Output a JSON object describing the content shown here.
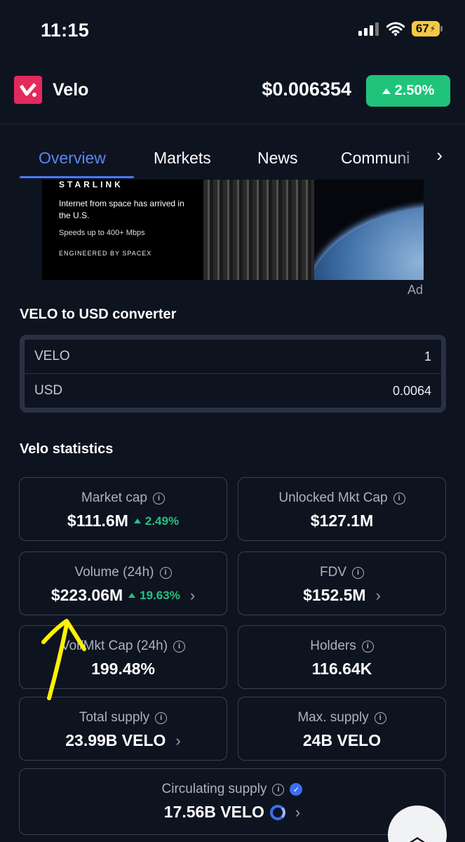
{
  "status_bar": {
    "time": "11:15",
    "battery": "67"
  },
  "header": {
    "coin_name": "Velo",
    "price": "$0.006354",
    "change": "2.50%",
    "logo_color": "#e4295c",
    "change_color": "#1fc47a"
  },
  "tabs": [
    {
      "label": "Overview",
      "active": true
    },
    {
      "label": "Markets"
    },
    {
      "label": "News"
    },
    {
      "label": "Communi"
    }
  ],
  "ad": {
    "brand": "STARLINK",
    "headline": "Internet from space has arrived in the U.S.",
    "speed": "Speeds up to 400+ Mbps",
    "engineered": "ENGINEERED BY SPACEX",
    "label": "Ad"
  },
  "converter": {
    "title": "VELO to USD converter",
    "rows": [
      {
        "label": "VELO",
        "value": "1"
      },
      {
        "label": "USD",
        "value": "0.0064"
      }
    ]
  },
  "stats": {
    "title": "Velo statistics",
    "market_cap": {
      "label": "Market cap",
      "value": "$111.6M",
      "change": "2.49%"
    },
    "unlocked_mkt_cap": {
      "label": "Unlocked Mkt Cap",
      "value": "$127.1M"
    },
    "volume": {
      "label": "Volume (24h)",
      "value": "$223.06M",
      "change": "19.63%"
    },
    "fdv": {
      "label": "FDV",
      "value": "$152.5M"
    },
    "vol_mkt_cap": {
      "label": "Vol/Mkt Cap (24h)",
      "value": "199.48%"
    },
    "holders": {
      "label": "Holders",
      "value": "116.64K"
    },
    "total_supply": {
      "label": "Total supply",
      "value": "23.99B VELO"
    },
    "max_supply": {
      "label": "Max. supply",
      "value": "24B VELO"
    },
    "circulating_supply": {
      "label": "Circulating supply",
      "value": "17.56B VELO"
    }
  },
  "colors": {
    "accent": "#4a79ef",
    "positive": "#26c27f",
    "background": "#0e1320",
    "annotation": "#fff200"
  }
}
